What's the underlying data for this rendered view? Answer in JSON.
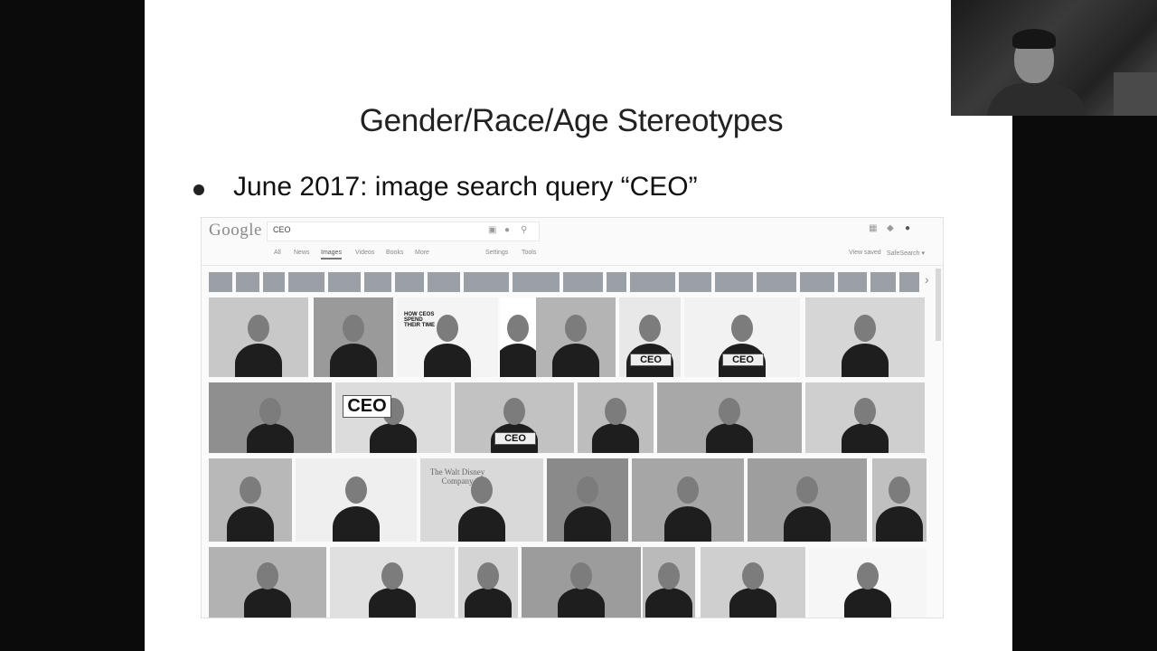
{
  "slide": {
    "title": "Gender/Race/Age Stereotypes",
    "bullet": "June 2017: image search query “CEO”"
  },
  "search_ui": {
    "logo": "Google",
    "query": "CEO",
    "icons": [
      "camera-icon",
      "mic-icon",
      "search-icon",
      "apps-icon",
      "notifications-icon",
      "account-icon"
    ],
    "tabs": [
      "All",
      "News",
      "Images",
      "Videos",
      "Books",
      "More"
    ],
    "active_tab": "Images",
    "tools": [
      "Settings",
      "Tools"
    ],
    "right_links": [
      "View saved",
      "SafeSearch ▾"
    ],
    "thumb_labels": {
      "ceos_time": "HOW CEOS SPEND THEIR TIME",
      "ceo_desk_1": "CEO",
      "ceo_desk_2": "CEO",
      "ceo_card": "CEO",
      "ceo_plaque": "CEO",
      "disney": "The Walt Disney Company"
    }
  },
  "colors": {
    "slide_bg": "#ffffff",
    "frame_bg": "#0b0b0b",
    "chip": "#9aa0a6"
  }
}
